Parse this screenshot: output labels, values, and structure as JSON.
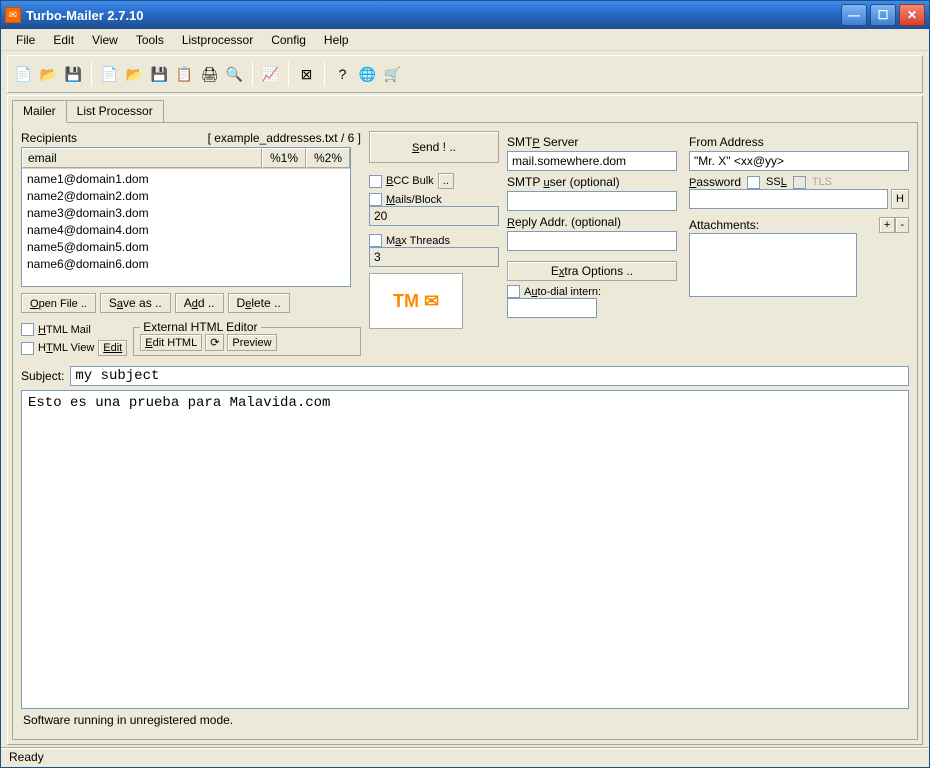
{
  "window": {
    "title": "Turbo-Mailer 2.7.10"
  },
  "menubar": [
    "File",
    "Edit",
    "View",
    "Tools",
    "Listprocessor",
    "Config",
    "Help"
  ],
  "tabs": {
    "mailer": "Mailer",
    "listproc": "List Processor"
  },
  "recipients": {
    "label": "Recipients",
    "file_info": "[ example_addresses.txt / 6 ]",
    "headers": {
      "email": "email",
      "c2": "%1%",
      "c3": "%2%"
    },
    "rows": [
      "name1@domain1.dom",
      "name2@domain2.dom",
      "name3@domain3.dom",
      "name4@domain4.dom",
      "name5@domain5.dom",
      "name6@domain6.dom"
    ],
    "open": "Open File ..",
    "saveas": "Save as ..",
    "add": "Add ..",
    "delete": "Delete .."
  },
  "htmlopts": {
    "html_mail": "HTML Mail",
    "html_view": "HTML View",
    "edit": "Edit",
    "group": "External HTML Editor",
    "edit_html": "Edit HTML",
    "preview": "Preview"
  },
  "send": {
    "button": "Send ! ..",
    "bcc_bulk": "BCC Bulk",
    "mails_block": "Mails/Block",
    "mails_block_val": "20",
    "max_threads": "Max Threads",
    "max_threads_val": "3"
  },
  "smtp": {
    "server_label": "SMTP Server",
    "server_val": "mail.somewhere.dom",
    "user_label": "SMTP user (optional)",
    "reply_label": "Reply Addr. (optional)",
    "extra": "Extra Options ..",
    "autodial": "Auto-dial intern:"
  },
  "from": {
    "label": "From Address",
    "val": "\"Mr. X\" <xx@yy>",
    "password": "Password",
    "ssl": "SSL",
    "tls": "TLS",
    "h": "H",
    "attachments": "Attachments:",
    "plus": "+",
    "minus": "-"
  },
  "subject": {
    "label": "Subject:",
    "val": "my subject"
  },
  "body": "Esto es una prueba para Malavida.com",
  "status": "Software running in unregistered mode.",
  "appstatus": "Ready"
}
